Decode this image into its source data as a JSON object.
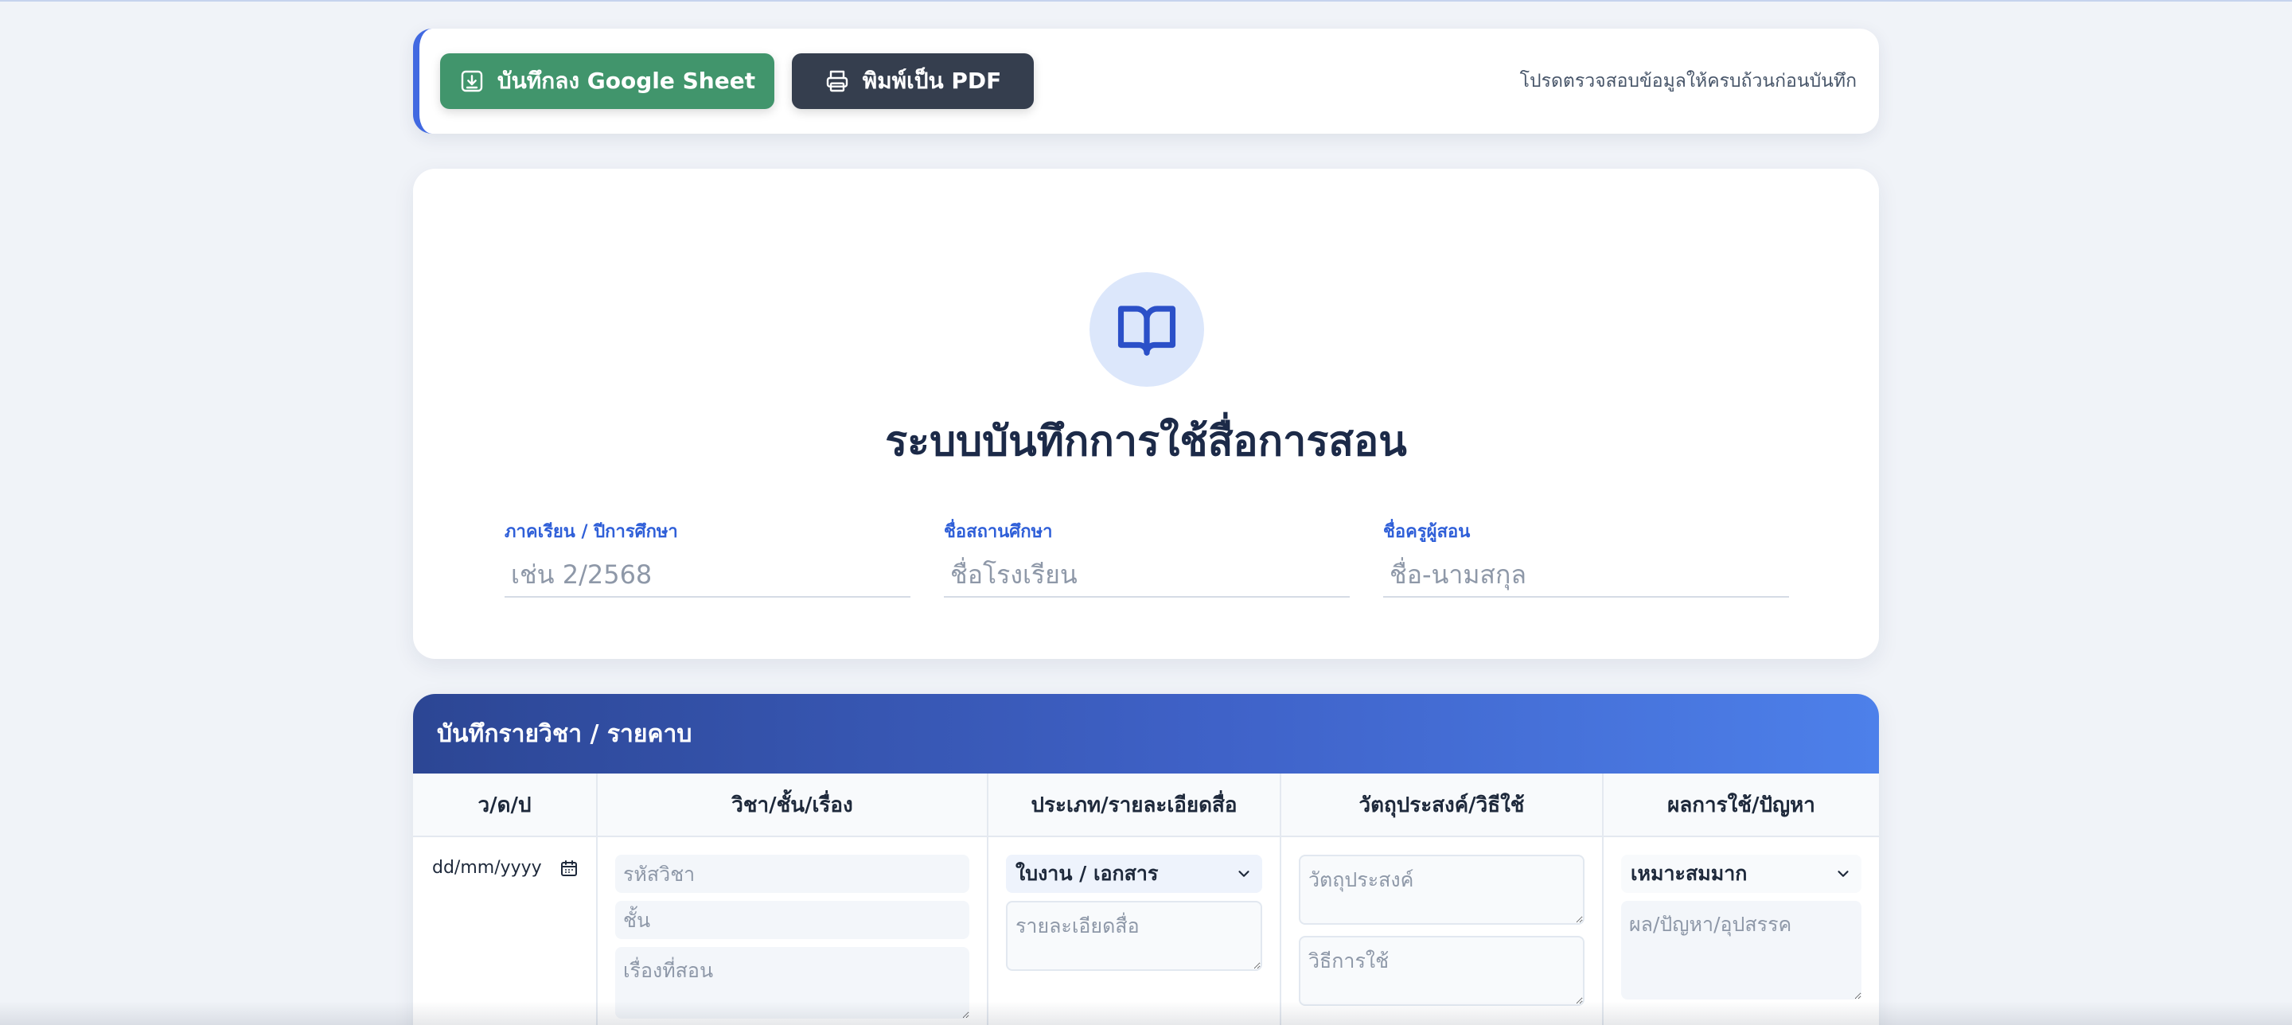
{
  "toolbar": {
    "save_sheet_label": "บันทึกลง Google Sheet",
    "print_pdf_label": "พิมพ์เป็น PDF",
    "note": "โปรดตรวจสอบข้อมูลให้ครบถ้วนก่อนบันทึก"
  },
  "header": {
    "title": "ระบบบันทึกการใช้สื่อการสอน",
    "fields": [
      {
        "label": "ภาคเรียน / ปีการศึกษา",
        "placeholder": "เช่น 2/2568"
      },
      {
        "label": "ชื่อสถานศึกษา",
        "placeholder": "ชื่อโรงเรียน"
      },
      {
        "label": "ชื่อครูผู้สอน",
        "placeholder": "ชื่อ-นามสกุล"
      }
    ]
  },
  "table": {
    "title": "บันทึกรายวิชา / รายคาบ",
    "columns": [
      "ว/ด/ป",
      "วิชา/ชั้น/เรื่อง",
      "ประเภท/รายละเอียดสื่อ",
      "วัตถุประสงค์/วิธีใช้",
      "ผลการใช้/ปัญหา"
    ],
    "row": {
      "date_value": "dd/mm/yyyy",
      "subject_code_placeholder": "รหัสวิชา",
      "grade_placeholder": "ชั้น",
      "topic_placeholder": "เรื่องที่สอน",
      "media_type_selected": "ใบงาน / เอกสาร",
      "media_detail_placeholder": "รายละเอียดสื่อ",
      "objective_placeholder": "วัตถุประสงค์",
      "method_placeholder": "วิธีการใช้",
      "result_selected": "เหมาะสมมาก",
      "result_note_placeholder": "ผล/ปัญหา/อุปสรรค"
    }
  },
  "colors": {
    "accent": "#4169e1",
    "sheet_button": "#41956c",
    "pdf_button": "#353e4e",
    "title": "#1c2a48"
  }
}
